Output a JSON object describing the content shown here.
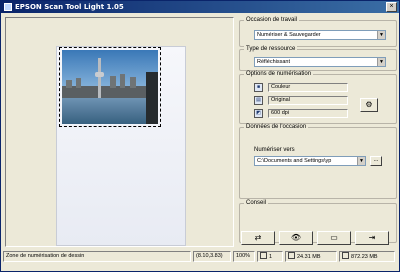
{
  "window": {
    "title": "EPSON Scan Tool Light 1.05",
    "close_label": "×"
  },
  "groups": {
    "occasion": {
      "legend": "Occasion de travail",
      "selected": "Numériser & Sauvegarder"
    },
    "resource": {
      "legend": "Type de ressource",
      "selected": "Réfléchissant"
    },
    "options": {
      "legend": "Options de numérisation",
      "items": [
        {
          "icon": "color-mode-icon",
          "value": "Couleur"
        },
        {
          "icon": "original-doc-icon",
          "value": "Original"
        },
        {
          "icon": "resolution-icon",
          "value": "600 dpi"
        }
      ]
    },
    "occasion_data": {
      "legend": "Données de l'occasion",
      "scan_to_label": "Numériser vers",
      "path": "C:\\Documents and Settings\\yp",
      "browse_label": "..."
    },
    "advice": {
      "legend": "Conseil"
    }
  },
  "actions": [
    {
      "name": "swap-button",
      "icon": "swap-arrows-icon",
      "glyph": "⇄"
    },
    {
      "name": "preview-button",
      "icon": "eye-icon",
      "glyph": "👁"
    },
    {
      "name": "scan-button",
      "icon": "scanner-icon",
      "glyph": "▭"
    },
    {
      "name": "exit-button",
      "icon": "exit-door-icon",
      "glyph": "⇥"
    }
  ],
  "status": {
    "hint": "Zone de numérisation de dessin",
    "coords": "(8.10,3.83)",
    "zoom": "100%",
    "pages": "1",
    "size": "24.31 MB",
    "free": "872.23 MB"
  }
}
